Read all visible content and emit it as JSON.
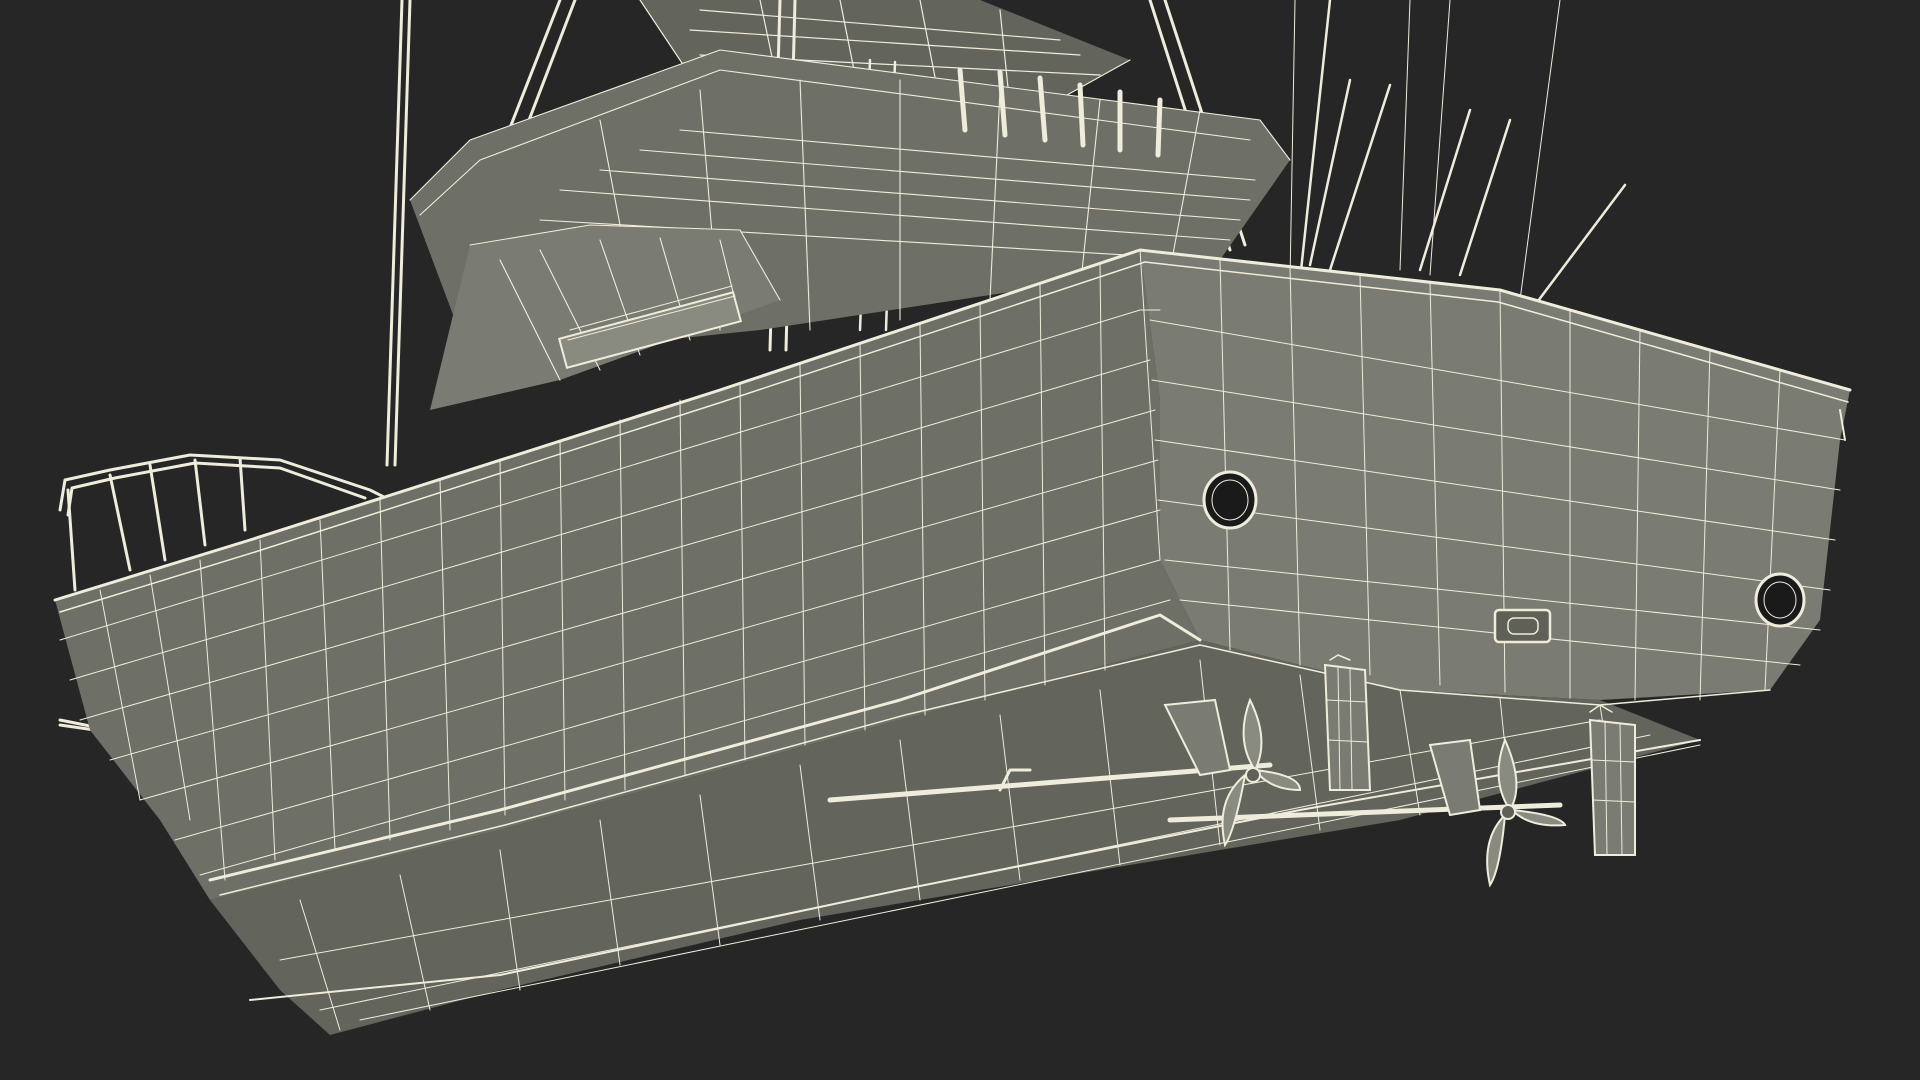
{
  "scene": {
    "background_color": "#262626",
    "hull_color": "#6e6f66",
    "wire_color": "#f0ecdc"
  }
}
